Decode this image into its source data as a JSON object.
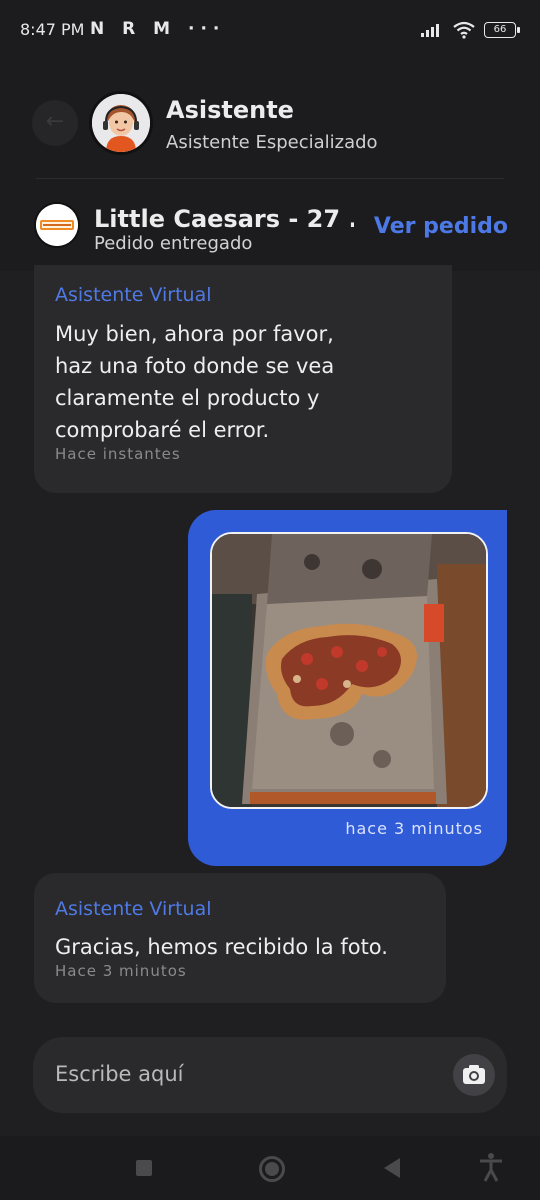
{
  "status_bar": {
    "time": "8:47 PM",
    "left_icons": "N R M ···",
    "battery": "66"
  },
  "header": {
    "title": "Asistente",
    "subtitle": "Asistente Especializado"
  },
  "order": {
    "store_name": "Little Caesars - 27 ...",
    "status": "Pedido entregado",
    "action_label": "Ver pedido"
  },
  "messages": [
    {
      "sender": "Asistente Virtual",
      "lines": [
        "Muy bien, ahora por favor,",
        "haz una foto donde se vea",
        "claramente el producto y",
        "comprobaré el error."
      ],
      "time": "Hace instantes"
    },
    {
      "outgoing": true,
      "time": "hace 3 minutos"
    },
    {
      "sender": "Asistente Virtual",
      "lines": [
        "Gracias, hemos recibido la foto."
      ],
      "time": "Hace 3 minutos"
    }
  ],
  "input": {
    "placeholder": "Escribe aquí"
  },
  "colors": {
    "accent": "#4f7ae6",
    "outgoing_bubble": "#2f5bd6",
    "background": "#1f1f21"
  }
}
